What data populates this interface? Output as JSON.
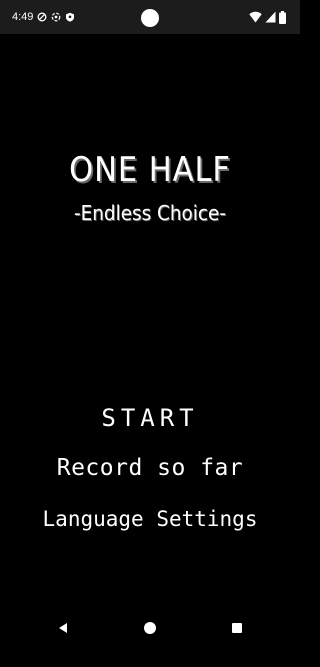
{
  "status_bar": {
    "time": "4:49",
    "icons_left": [
      "privacy-shield-icon",
      "data-saver-icon",
      "vpn-key-icon"
    ],
    "icons_right": [
      "wifi-icon",
      "cellular-signal-icon",
      "battery-icon"
    ]
  },
  "game": {
    "title": "ONE HALF",
    "subtitle": "-Endless Choice-"
  },
  "menu": {
    "start_label": "START",
    "record_label": "Record so far",
    "language_label": "Language Settings"
  },
  "nav_bar": {
    "icons": [
      "back-icon",
      "home-icon",
      "recents-icon"
    ]
  },
  "colors": {
    "background": "#000000",
    "status_bar": "#1c1c1c",
    "text": "#ffffff",
    "title_shadow": "#6a6a6a"
  }
}
